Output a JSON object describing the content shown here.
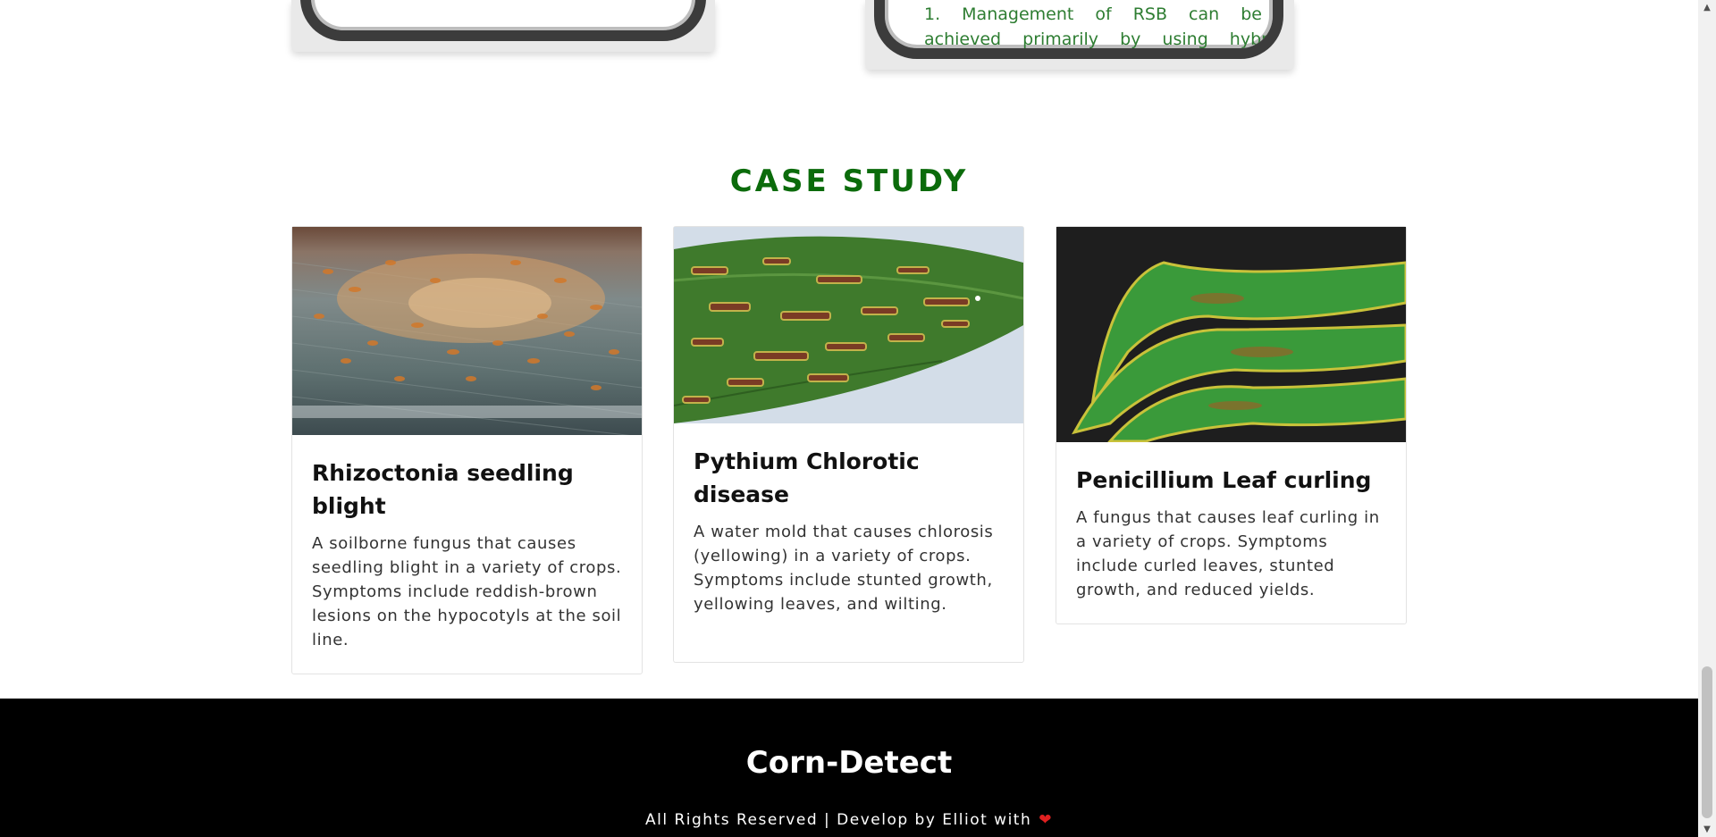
{
  "top_mockup": {
    "right_text_line1": "1. Management of RSB can be",
    "right_text_line2": "achieved primarily by using hybrid"
  },
  "case_study": {
    "title": "CASE STUDY",
    "cards": [
      {
        "title": "Rhizoctonia seedling blight",
        "description": "A soilborne fungus that causes seedling blight in a variety of crops. Symptoms include reddish-brown lesions on the hypocotyls at the soil line."
      },
      {
        "title": "Pythium Chlorotic disease",
        "description": "A water mold that causes chlorosis (yellowing) in a variety of crops. Symptoms include stunted growth, yellowing leaves, and wilting."
      },
      {
        "title": "Penicillium Leaf curling",
        "description": "A fungus that causes leaf curling in a variety of crops. Symptoms include curled leaves, stunted growth, and reduced yields."
      }
    ]
  },
  "footer": {
    "brand": "Corn-Detect",
    "copyright": "All Rights Reserved | Develop by Elliot with",
    "heart_icon": "heart-icon",
    "heart_color": "#e02020"
  },
  "colors": {
    "heading_green": "#0b6b0b",
    "mockup_text_green": "#2e7d32",
    "footer_bg": "#000000"
  }
}
